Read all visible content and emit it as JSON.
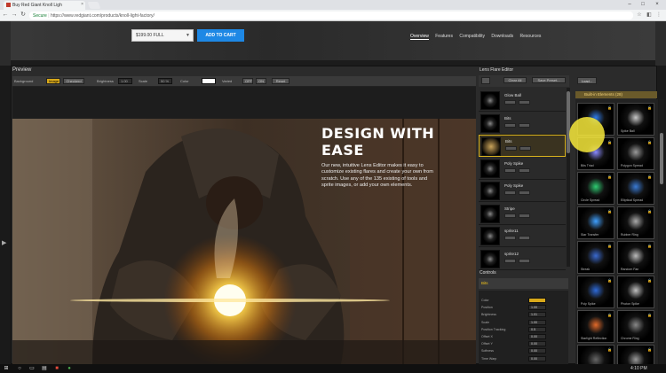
{
  "browser": {
    "tab_title": "Buy Red Giant Knoll Ligh",
    "url_secure": "Secure",
    "url": "https://www.redgiant.com/products/knoll-light-factory/"
  },
  "site": {
    "price_select": "$199.00 FULL",
    "add_to_cart": "ADD TO CART",
    "nav": [
      "Overview",
      "Features",
      "Compatibility",
      "Downloads",
      "Resources"
    ]
  },
  "preview": {
    "title": "Preview",
    "background_label": "Background",
    "bg_image": "Image",
    "bg_checkerd": "Checkerd",
    "brightness_label": "Brightness",
    "brightness_value": "1.00",
    "scale_label": "Scale",
    "scale_value": "50 %",
    "color_label": "Color",
    "varied_label": "Varied",
    "varied_opt1": "OFF",
    "varied_opt2": "ON",
    "reset": "Reset"
  },
  "promo": {
    "heading": "DESIGN WITH EASE",
    "text": "Our new, intuitive Lens Editor makes it easy to customize existing flares and create your own from scratch. Use any of the 135 existing of tools and sprite images, or add your own elements."
  },
  "editor": {
    "title": "Lens Flare Editor",
    "clear_all": "Clear All",
    "save_preset": "Save Preset...",
    "load": "Load...",
    "items": [
      {
        "name": "Glow Ball",
        "selected": false
      },
      {
        "name": "Bits",
        "selected": false
      },
      {
        "name": "Bits",
        "selected": true
      },
      {
        "name": "Poly Spike",
        "selected": false
      },
      {
        "name": "Poly Spike",
        "selected": false
      },
      {
        "name": "Stripe",
        "selected": false
      },
      {
        "name": "sprite11",
        "selected": false
      },
      {
        "name": "sprite12",
        "selected": false
      }
    ]
  },
  "controls": {
    "title": "Controls",
    "selected": "Bits",
    "rows": [
      {
        "label": "Color",
        "value": ""
      },
      {
        "label": "Position",
        "value": "1.00"
      },
      {
        "label": "Brightness",
        "value": "1.01"
      },
      {
        "label": "Scale",
        "value": "1.00"
      },
      {
        "label": "Position Tracking",
        "value": "0.5"
      },
      {
        "label": "Offset X",
        "value": "0.00"
      },
      {
        "label": "Offset Y",
        "value": "0.00"
      },
      {
        "label": "Softness",
        "value": "0.00"
      },
      {
        "label": "Time Warp",
        "value": "0.00"
      }
    ]
  },
  "elements": {
    "header": "Built-in Elements (28)",
    "tiles": [
      "",
      "Spike Ball",
      "Bits Triad",
      "Polygon Spread",
      "Circle Spread",
      "Elliptical Spread",
      "Star Transfer",
      "Rubber Ring",
      "Streak",
      "Random Fan",
      "Poly Spike",
      "Photon Spike",
      "Starlight Reflection",
      "Chrome Ring",
      "",
      ""
    ]
  },
  "taskbar": {
    "time": "4:10 PM"
  },
  "colors": {
    "accent_blue": "#1e88e5",
    "gold": "#d8a81a"
  }
}
